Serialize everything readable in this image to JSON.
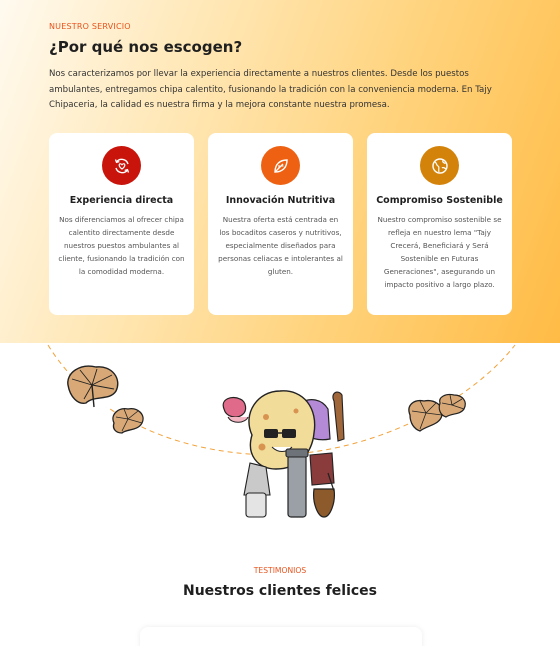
{
  "service": {
    "eyebrow": "NUESTRO SERVICIO",
    "title": "¿Por qué nos escogen?",
    "intro": "Nos caracterizamos por llevar la experiencia directamente a nuestros clientes. Desde los puestos ambulantes, entregamos chipa calentito, fusionando la tradición con la conveniencia moderna. En Tajy Chipaceria, la calidad es nuestra firma y la mejora constante nuestra promesa.",
    "cards": [
      {
        "title": "Experiencia directa",
        "text": "Nos diferenciamos al ofrecer chipa calentito directamente desde nuestros puestos ambulantes al cliente, fusionando la tradición con la comodidad moderna.",
        "icon": "heart-refresh-icon",
        "color": "#c8140a"
      },
      {
        "title": "Innovación Nutritiva",
        "text": "Nuestra oferta está centrada en los bocaditos caseros y nutritivos, especialmente diseñados para personas celiacas e intolerantes al gluten.",
        "icon": "leaf-icon",
        "color": "#ee6112"
      },
      {
        "title": "Compromiso Sostenible",
        "text": "Nuestro compromiso sostenible se refleja en nuestro lema \"Tajy Crecerá, Beneficiará y Será Sostenible en Futuras Generaciones\", asegurando un impacto positivo a largo plazo.",
        "icon": "globe-icon",
        "color": "#d4830a"
      }
    ]
  },
  "testimonials": {
    "eyebrow": "TESTIMONIOS",
    "title": "Nuestros clientes felices"
  }
}
